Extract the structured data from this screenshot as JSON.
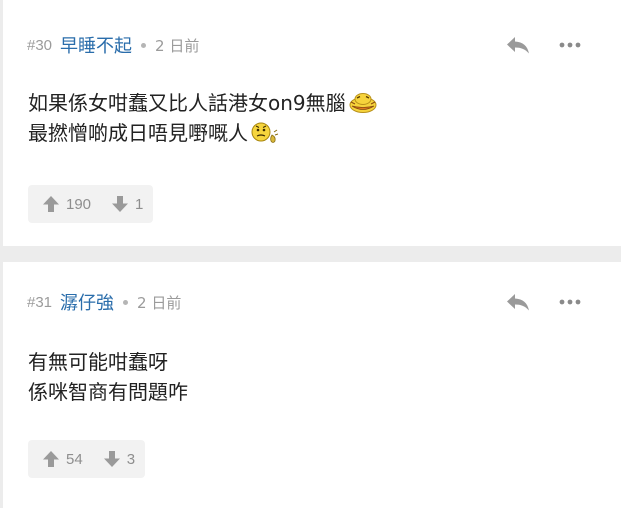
{
  "posts": [
    {
      "floor": "#30",
      "username": "早睡不起",
      "time": "2 日前",
      "lines": [
        "如果係女咁蠢又比人話港女on9無腦",
        "最撚憎啲成日唔見嘢嘅人"
      ],
      "line_emoji": [
        "laughing-duck-emoji",
        "sweat-smiley-emoji"
      ],
      "upvotes": "190",
      "downvotes": "1"
    },
    {
      "floor": "#31",
      "username": "潺仔強",
      "time": "2 日前",
      "lines": [
        "有無可能咁蠢呀",
        "係咪智商有問題咋"
      ],
      "upvotes": "54",
      "downvotes": "3"
    }
  ],
  "colors": {
    "username": "#2a6dab",
    "meta": "#9b9b9b",
    "text": "#222222",
    "vote_bg": "#f2f2f2",
    "page_bg": "#ececec",
    "icon": "#9a9a9a"
  },
  "icons": {
    "reply": "reply-arrow-icon",
    "more": "more-horizontal-icon",
    "upvote": "thumb-up-arrow-icon",
    "downvote": "thumb-down-arrow-icon"
  }
}
